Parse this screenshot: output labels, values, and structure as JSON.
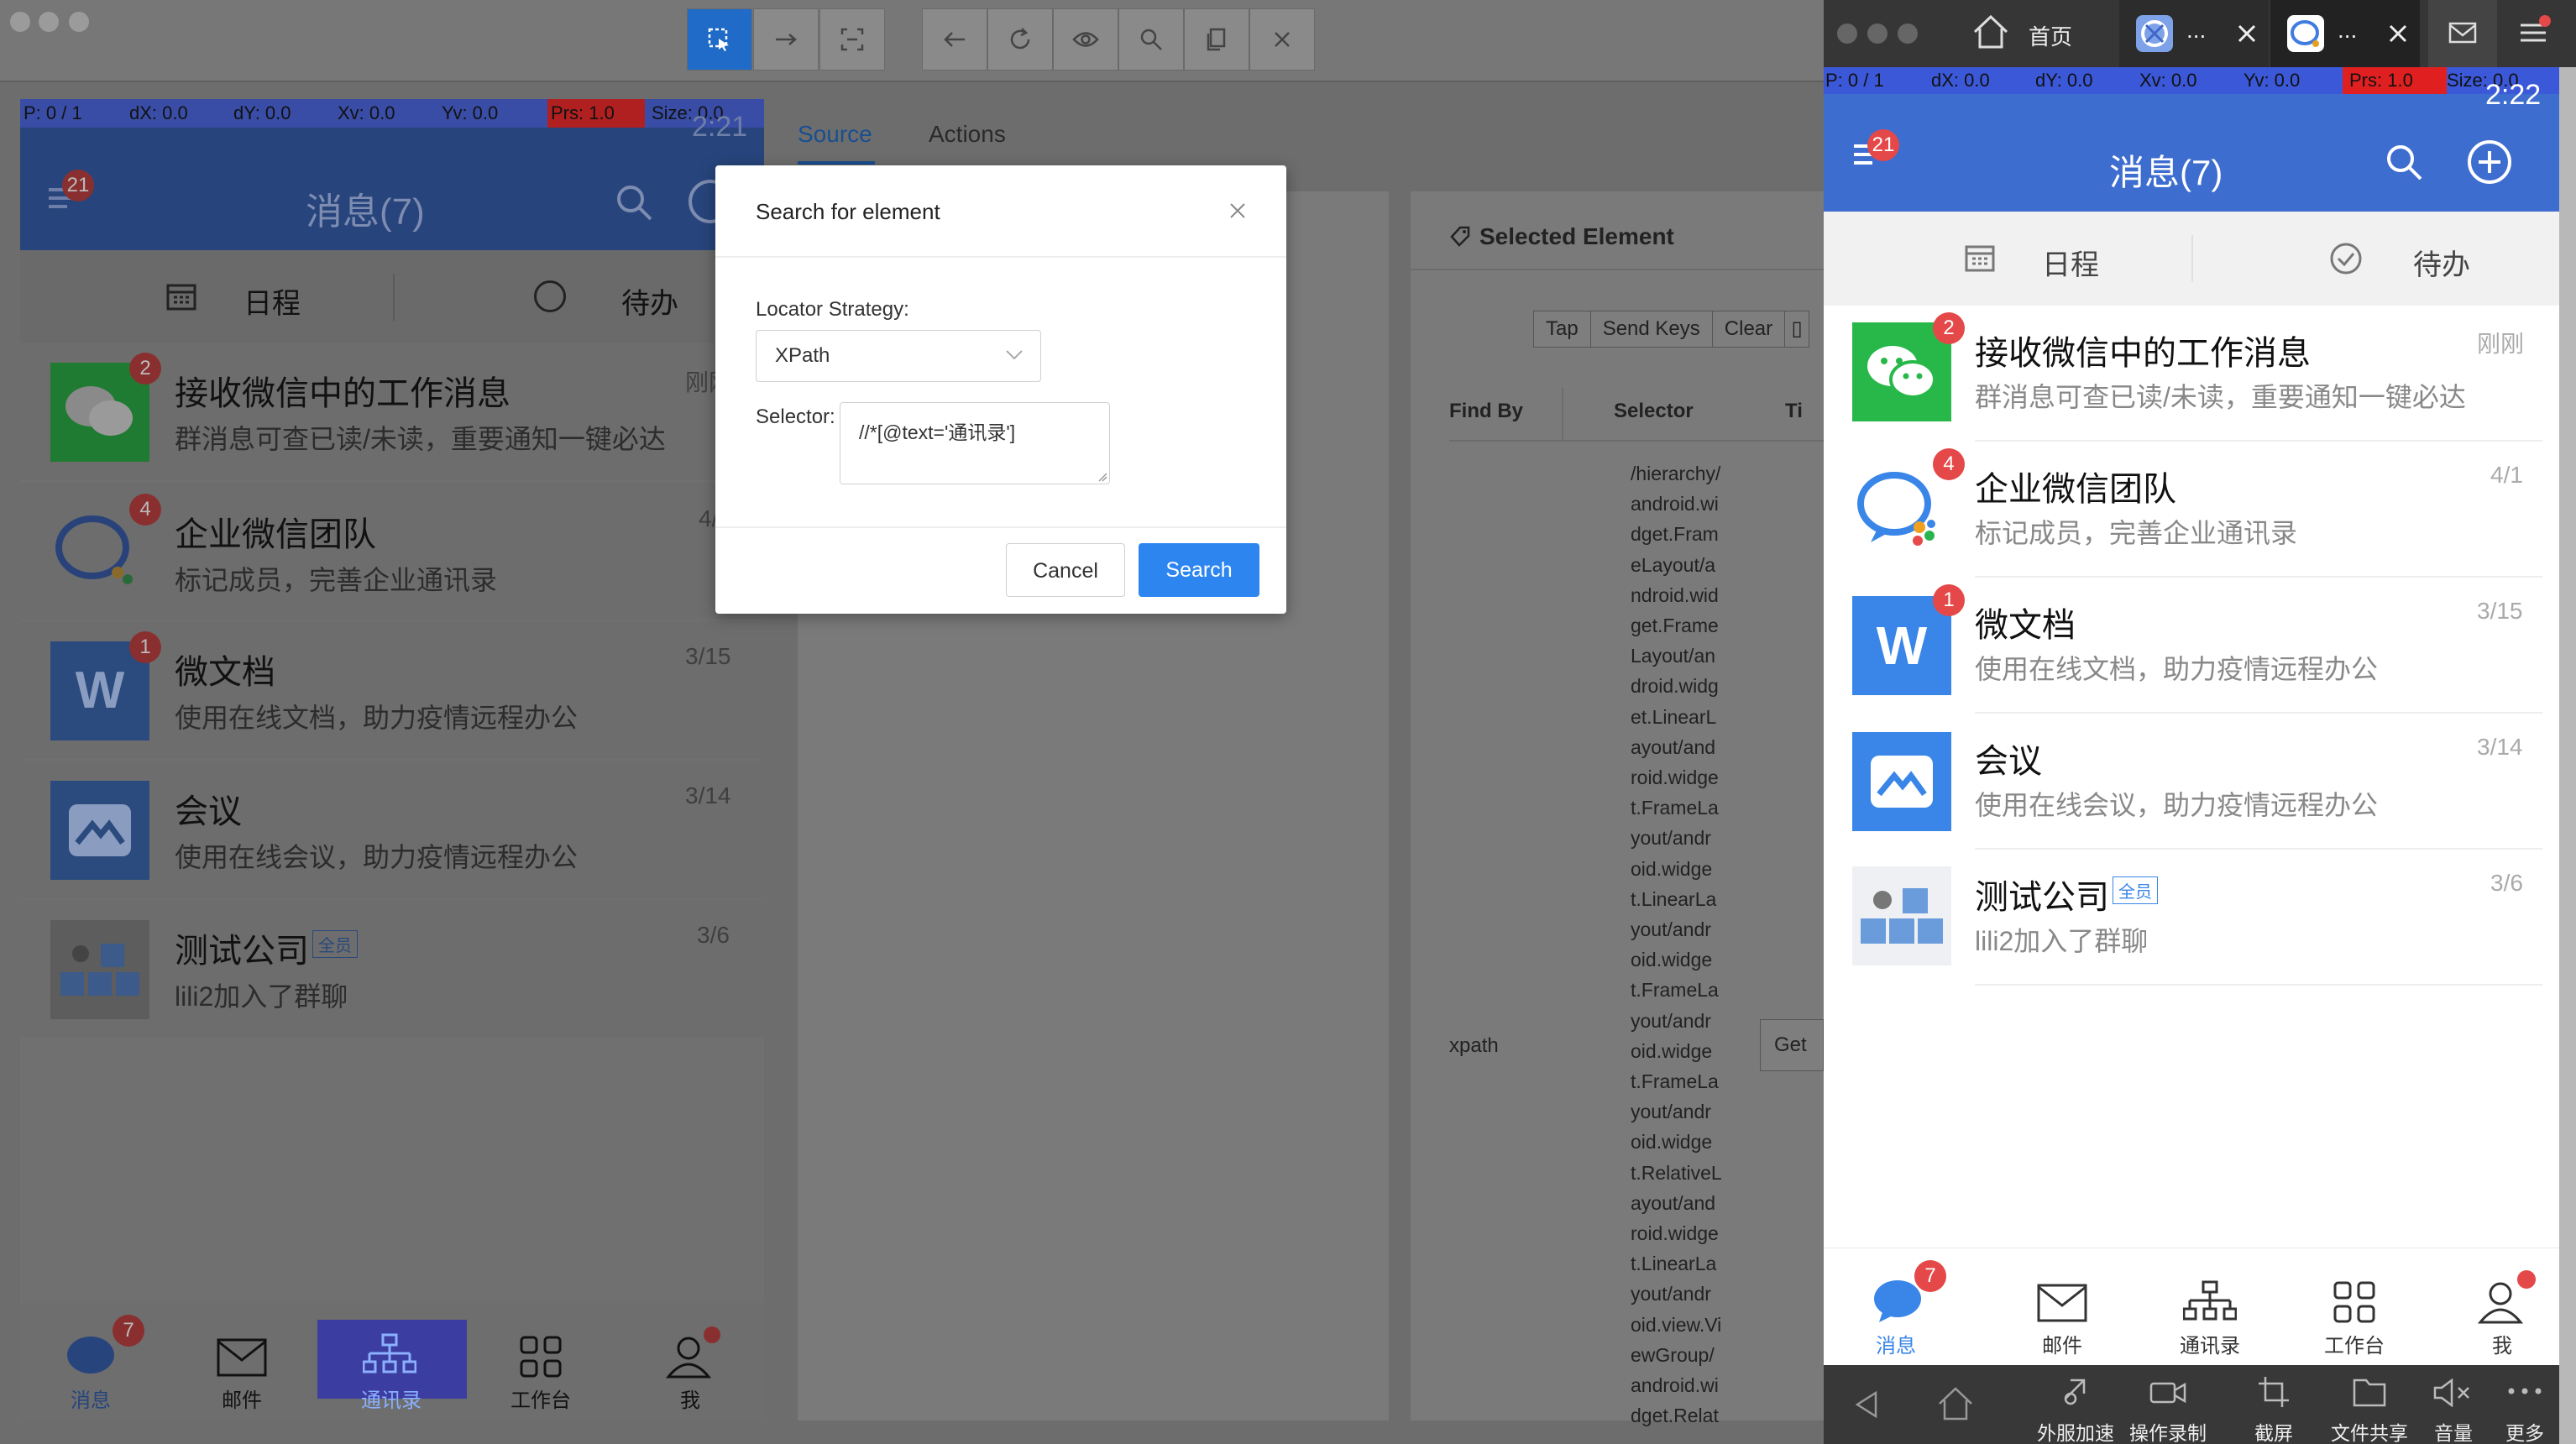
{
  "colors": {
    "accent_blue": "#2d86f0",
    "phone_head": "#3e6dd0",
    "badge_red": "#e54848",
    "wechat_green": "#28b84a"
  },
  "toolbar": {
    "icons": [
      "select-element-icon",
      "swipe-icon",
      "tap-coordinates-icon",
      "back-icon",
      "refresh-icon",
      "eye-icon",
      "search-icon",
      "copy-xml-icon",
      "quit-session-icon"
    ]
  },
  "inspector": {
    "tabs": [
      "Source",
      "Actions"
    ],
    "selected_element_title": "Selected Element",
    "actions": [
      "Tap",
      "Send Keys",
      "Clear"
    ],
    "table_headers": {
      "find_by": "Find By",
      "selector": "Selector",
      "time": "Ti"
    },
    "row": {
      "find_by": "xpath",
      "get_button": "Get"
    },
    "xpath_lines": [
      "/hierarchy/",
      "android.wi",
      "dget.Fram",
      "eLayout/a",
      "ndroid.wid",
      "get.Frame",
      "Layout/an",
      "droid.widg",
      "et.LinearL",
      "ayout/and",
      "roid.widge",
      "t.FrameLa",
      "yout/andr",
      "oid.widge",
      "t.LinearLa",
      "yout/andr",
      "oid.widge",
      "t.FrameLa",
      "yout/andr",
      "oid.widge",
      "t.FrameLa",
      "yout/andr",
      "oid.widge",
      "t.RelativeL",
      "ayout/and",
      "roid.widge",
      "t.LinearLa",
      "yout/andr",
      "oid.view.Vi",
      "ewGroup/",
      "android.wi",
      "dget.Relat"
    ]
  },
  "modal": {
    "title": "Search for element",
    "locator_label": "Locator Strategy:",
    "locator_value": "XPath",
    "selector_label": "Selector:",
    "selector_value": "//*[@text='通讯录']",
    "cancel": "Cancel",
    "search": "Search"
  },
  "left_phone": {
    "pointer": {
      "p": "P: 0 / 1",
      "dx": "dX: 0.0",
      "dy": "dY: 0.0",
      "xv": "Xv: 0.0",
      "yv": "Yv: 0.0",
      "prs": "Prs: 1.0",
      "size": "Size: 0.0"
    },
    "time": "2:21",
    "menu_badge": "21",
    "title": "消息(7)",
    "tab_schedule": "日程",
    "tab_todo": "待办",
    "items": [
      {
        "name": "接收微信中的工作消息",
        "sub": "群消息可查已读/未读，重要通知一键必达",
        "date": "刚刚",
        "badge": "2"
      },
      {
        "name": "企业微信团队",
        "sub": "标记成员，完善企业通讯录",
        "date": "4/1",
        "badge": "4"
      },
      {
        "name": "微文档",
        "sub": "使用在线文档，助力疫情远程办公",
        "date": "3/15",
        "badge": "1"
      },
      {
        "name": "会议",
        "sub": "使用在线会议，助力疫情远程办公",
        "date": "3/14"
      },
      {
        "name": "测试公司",
        "tag": "全员",
        "sub": "lili2加入了群聊",
        "date": "3/6"
      }
    ],
    "nav": [
      {
        "label": "消息",
        "badge": "7"
      },
      {
        "label": "邮件"
      },
      {
        "label": "通讯录"
      },
      {
        "label": "工作台"
      },
      {
        "label": "我"
      }
    ]
  },
  "right_window": {
    "tabs": [
      {
        "label": "首页"
      },
      {
        "label": "..."
      },
      {
        "label": "..."
      }
    ],
    "pointer": {
      "p": "P: 0 / 1",
      "dx": "dX: 0.0",
      "dy": "dY: 0.0",
      "xv": "Xv: 0.0",
      "yv": "Yv: 0.0",
      "prs": "Prs: 1.0",
      "size": "Size: 0.0"
    },
    "time": "2:22",
    "menu_badge": "21",
    "title": "消息(7)",
    "tab_schedule": "日程",
    "tab_todo": "待办",
    "items": [
      {
        "name": "接收微信中的工作消息",
        "sub": "群消息可查已读/未读，重要通知一键必达",
        "date": "刚刚",
        "badge": "2"
      },
      {
        "name": "企业微信团队",
        "sub": "标记成员，完善企业通讯录",
        "date": "4/1",
        "badge": "4"
      },
      {
        "name": "微文档",
        "sub": "使用在线文档，助力疫情远程办公",
        "date": "3/15",
        "badge": "1"
      },
      {
        "name": "会议",
        "sub": "使用在线会议，助力疫情远程办公",
        "date": "3/14"
      },
      {
        "name": "测试公司",
        "tag": "全员",
        "sub": "lili2加入了群聊",
        "date": "3/6"
      }
    ],
    "nav": [
      {
        "label": "消息",
        "badge": "7"
      },
      {
        "label": "邮件"
      },
      {
        "label": "通讯录"
      },
      {
        "label": "工作台"
      },
      {
        "label": "我"
      }
    ],
    "system_bar": [
      "外服加速",
      "操作录制",
      "截屏",
      "文件共享",
      "音量",
      "更多"
    ]
  }
}
